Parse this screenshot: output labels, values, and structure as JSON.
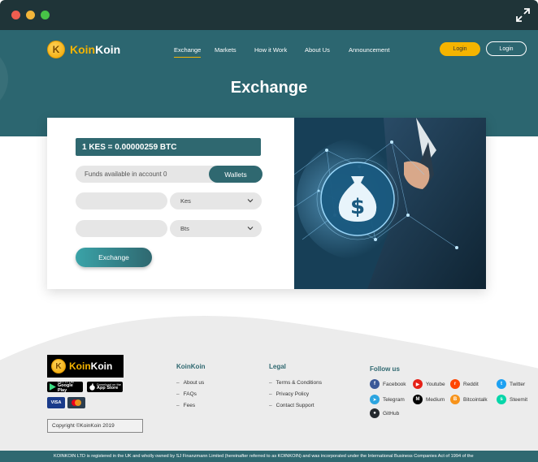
{
  "brand": {
    "name_part1": "Koin",
    "name_part2": "Koin",
    "coin_letter": "K"
  },
  "nav": {
    "items": [
      {
        "label": "Exchange",
        "active": true
      },
      {
        "label": "Markets"
      },
      {
        "label": "How it Work"
      },
      {
        "label": "About Us"
      },
      {
        "label": "Announcement"
      }
    ],
    "login_primary": "Login",
    "login_secondary": "Login"
  },
  "hero": {
    "title": "Exchange"
  },
  "exchange": {
    "rate": "1 KES = 0.00000259 BTC",
    "funds_text": "Funds available in account 0",
    "wallets_label": "Wallets",
    "from_amount": "",
    "from_currency": "Kes",
    "to_amount": "",
    "to_currency": "Bts",
    "submit_label": "Exchange"
  },
  "footer": {
    "stores": {
      "google_small": "GET IT ON",
      "google_big": "Google Play",
      "apple_small": "Download on the",
      "apple_big": "App Store"
    },
    "payments": {
      "visa": "VISA",
      "mastercard": "MC"
    },
    "copyright": "Copyright ©KoinKoin 2019",
    "koinkoin_title": "KoinKoin",
    "koinkoin_links": [
      "About us",
      "FAQs",
      "Fees"
    ],
    "legal_title": "Legal",
    "legal_links": [
      "Terms & Conditions",
      "Privacy Policy",
      "Contact Support"
    ],
    "follow_title": "Follow us",
    "social": [
      {
        "label": "Facebook",
        "color": "#3b5998"
      },
      {
        "label": "Youtube",
        "color": "#e62117"
      },
      {
        "label": "Reddit",
        "color": "#ff4500"
      },
      {
        "label": "Twitter",
        "color": "#1da1f2"
      },
      {
        "label": "Telegram",
        "color": "#2ca5e0"
      },
      {
        "label": "Medium",
        "color": "#000000"
      },
      {
        "label": "Bitcointalk",
        "color": "#f7931a"
      },
      {
        "label": "Steemit",
        "color": "#06d6a9"
      },
      {
        "label": "GitHub",
        "color": "#24292e"
      }
    ],
    "legal_notice": "KOINKOIN LTD is registered in the UK and wholly owned by SJ Finanzmann Limited (hereinafter referred to as KOINKOIN) and was incorporated under the International Business Companies Act of 1994 of the"
  },
  "colors": {
    "primary": "#2f6870",
    "accent": "#f5b400",
    "hero_bg": "#2c6670"
  }
}
